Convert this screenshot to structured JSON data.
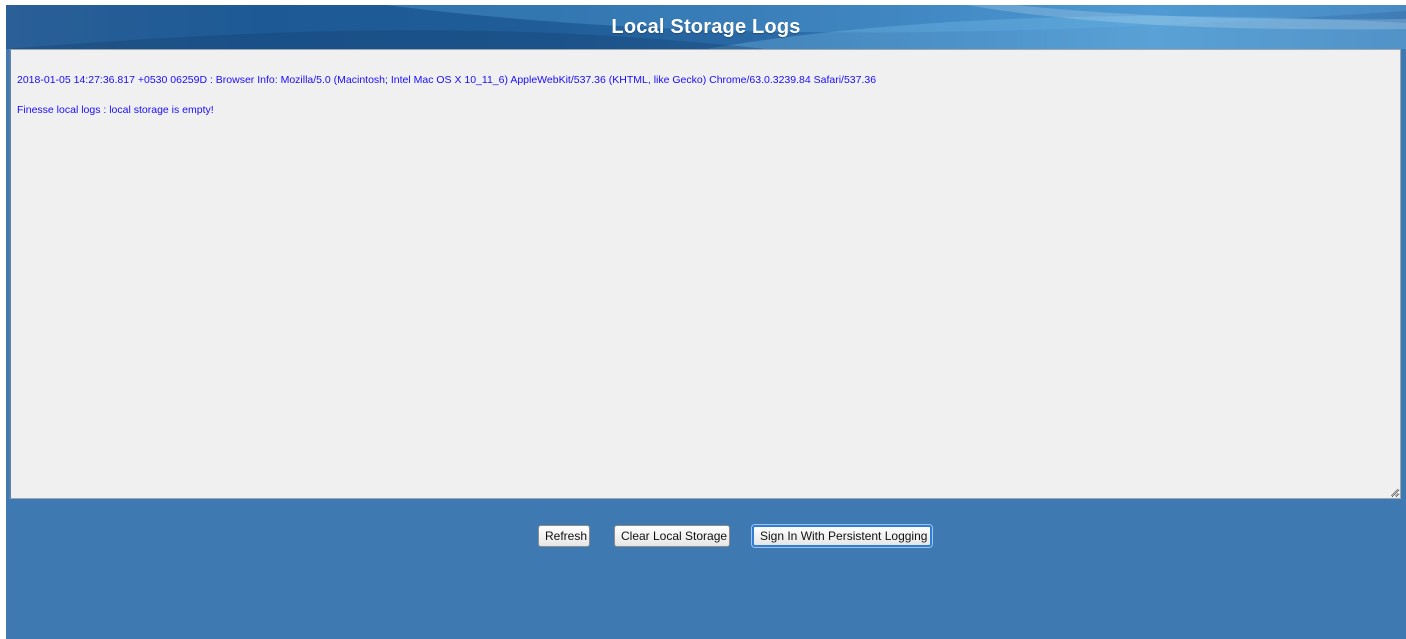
{
  "header": {
    "title": "Local Storage Logs"
  },
  "log_area": {
    "lines": [
      "2018-01-05 14:27:36.817 +0530 06259D : Browser Info: Mozilla/5.0 (Macintosh; Intel Mac OS X 10_11_6) AppleWebKit/537.36 (KHTML, like Gecko) Chrome/63.0.3239.84 Safari/537.36",
      "Finesse local logs : local storage is empty!"
    ],
    "text_color": "#1a0dff",
    "background_color": "#f0f0f0"
  },
  "buttons": {
    "refresh": "Refresh",
    "clear": "Clear Local Storage",
    "persistent": "Sign In With Persistent Logging"
  },
  "colors": {
    "page_background": "#3f79b2",
    "header_accent": "#1d5a95",
    "focus_ring": "#2f7fd6"
  }
}
